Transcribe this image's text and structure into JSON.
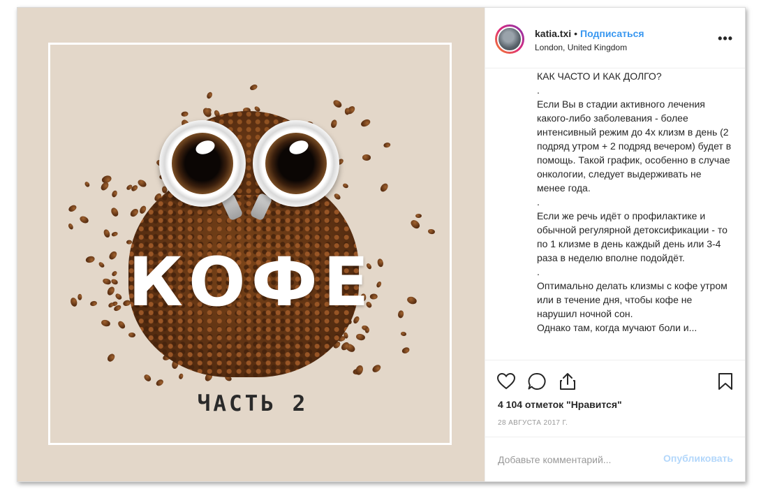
{
  "post": {
    "image": {
      "title": "КОФЕ",
      "subtitle": "ЧАСТЬ 2",
      "background": "#e3d7c9"
    },
    "header": {
      "username": "katia.txi",
      "separator": "•",
      "follow_label": "Подписаться",
      "location": "London, United Kingdom",
      "more_icon": "more-horizontal-icon",
      "more_label": "•••"
    },
    "caption": [
      "КАК ЧАСТО И КАК ДОЛГО?",
      ".",
      "Если Вы в стадии активного лечения какого-либо заболевания - более интенсивный режим до 4х клизм в день (2 подряд утром + 2 подряд вечером) будет в помощь. Такой график, особенно в случае онкологии, следует выдерживать не менее года.",
      ".",
      "Если же речь идёт о профилактике и обычной регулярной детоксификации - то по 1 клизме в день каждый день или 3-4 раза в неделю вполне подойдёт.",
      ".",
      "Оптимально делать клизмы с кофе утром или в течение дня, чтобы кофе не нарушил ночной сон.",
      "Однако там, когда мучают боли и..."
    ],
    "actions": {
      "icons": [
        "heart-icon",
        "comment-icon",
        "share-icon",
        "bookmark-icon"
      ]
    },
    "likes": "4 104 отметок \"Нравится\"",
    "date": "28 АВГУСТА 2017 Г.",
    "comment": {
      "placeholder": "Добавьте комментарий...",
      "publish_label": "Опубликовать"
    },
    "colors": {
      "accent": "#3897f0",
      "publish_disabled": "#b3d7fb",
      "text": "#262626",
      "muted": "#999999"
    }
  }
}
